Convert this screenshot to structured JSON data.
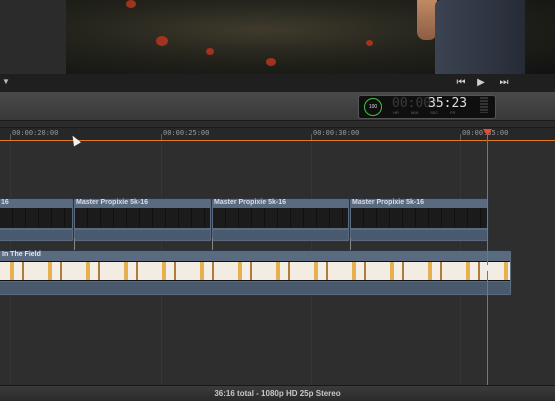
{
  "viewer": {
    "play_icon": "play-icon",
    "prev_icon": "skip-back-icon",
    "next_icon": "skip-forward-icon"
  },
  "dashboard": {
    "percent": "100",
    "timecode_dim": "00:00:",
    "timecode_main": "35:23",
    "labels": [
      "HR",
      "MIN",
      "SEC",
      "FR"
    ]
  },
  "ruler": {
    "labels": [
      "00:00:20:00",
      "00:00:25:00",
      "00:00:30:00",
      "00:00:35:00"
    ]
  },
  "clips": {
    "top": [
      {
        "name": "16"
      },
      {
        "name": "Master Propixie 5k-16"
      },
      {
        "name": "Master Propixie 5k-16"
      },
      {
        "name": "Master Propixie 5k-16"
      }
    ],
    "main": {
      "name": "In The Field"
    }
  },
  "status": {
    "text": "36:16 total - 1080p HD 25p Stereo"
  },
  "colors": {
    "playhead": "#e84a36",
    "clip": "#5a6b80",
    "ruler_line": "#e07a28"
  }
}
